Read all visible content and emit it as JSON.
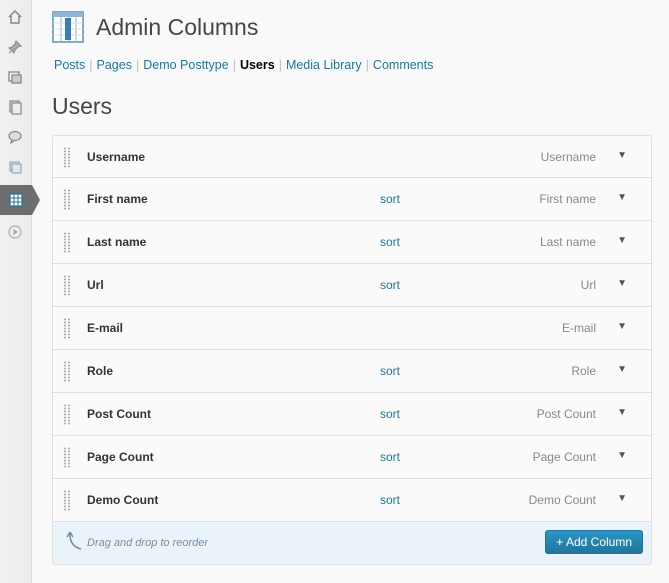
{
  "header": {
    "title": "Admin Columns"
  },
  "subnav": {
    "items": [
      {
        "label": "Posts",
        "current": false
      },
      {
        "label": "Pages",
        "current": false
      },
      {
        "label": "Demo Posttype",
        "current": false
      },
      {
        "label": "Users",
        "current": true
      },
      {
        "label": "Media Library",
        "current": false
      },
      {
        "label": "Comments",
        "current": false
      }
    ],
    "separator": "|"
  },
  "section": {
    "title": "Users"
  },
  "columns": [
    {
      "label": "Username",
      "sort": "",
      "type": "Username"
    },
    {
      "label": "First name",
      "sort": "sort",
      "type": "First name"
    },
    {
      "label": "Last name",
      "sort": "sort",
      "type": "Last name"
    },
    {
      "label": "Url",
      "sort": "sort",
      "type": "Url"
    },
    {
      "label": "E-mail",
      "sort": "",
      "type": "E-mail"
    },
    {
      "label": "Role",
      "sort": "sort",
      "type": "Role"
    },
    {
      "label": "Post Count",
      "sort": "sort",
      "type": "Post Count"
    },
    {
      "label": "Page Count",
      "sort": "sort",
      "type": "Page Count"
    },
    {
      "label": "Demo Count",
      "sort": "sort",
      "type": "Demo Count"
    }
  ],
  "toggle_glyph": "▼",
  "footer": {
    "drag_hint": "Drag and drop to reorder",
    "add_button": "+ Add Column"
  },
  "sidebar": {
    "icons": [
      "dashboard-icon",
      "pin-icon",
      "media-icon",
      "pages-icon",
      "comments-icon",
      "plugins-icon",
      "admin-columns-icon",
      "play-icon"
    ]
  },
  "colors": {
    "link": "#21759b",
    "button": "#21759b",
    "footer_bg": "#eaf2fa",
    "sidebar_active": "#6d6d6d"
  }
}
